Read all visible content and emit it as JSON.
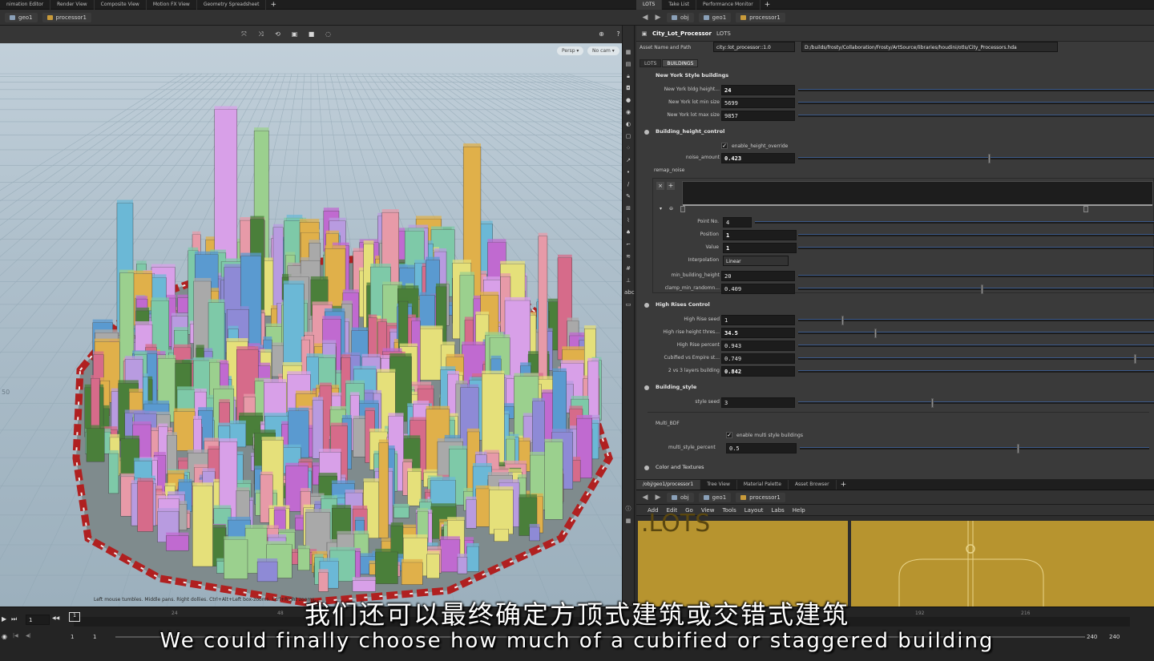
{
  "left_tabs": [
    "nimation Editor",
    "Render View",
    "Composite View",
    "Motion FX View",
    "Geometry Spreadsheet"
  ],
  "right_tabs": [
    "LOTS",
    "Take List",
    "Performance Monitor"
  ],
  "left_path": {
    "network": "geo1",
    "node": "processor1"
  },
  "right_path": {
    "obj": "obj",
    "network": "geo1",
    "node": "processor1"
  },
  "viewport": {
    "persp_label": "Persp ▾",
    "cam_label": "No cam ▾",
    "hint": "Left mouse tumbles. Middle pans. Right dollies. Ctrl+Alt+Left box-zooms. Ctrl+Right zooms.",
    "grid_label": "50"
  },
  "params": {
    "node_name": "City_Lot_Processor",
    "node_type": "LOTS",
    "asset_label": "Asset Name and Path",
    "asset_name": "city::lot_processor::1.0",
    "asset_path": "D:/builds/frosty/Collaboration/Frosty/ArtSource/libraries/houdini/otls/City_Processors.hda",
    "subtabs": [
      "LOTS",
      "BUILDINGS"
    ],
    "ny_folder": "New York Style buildings",
    "ny_height_label": "New York bldg height...",
    "ny_height": "24",
    "ny_min_label": "New York lot min size",
    "ny_min": "5699",
    "ny_max_label": "New York lot max size",
    "ny_max": "9857",
    "bhc_folder": "Building_height_control",
    "override_label": "enable_height_override",
    "noise_label": "noise_amount",
    "noise": "0.423",
    "remap_label": "remap_noise",
    "point_no_label": "Point No.",
    "point_no": "4",
    "position_label": "Position",
    "position": "1",
    "value_label": "Value",
    "value": "1",
    "interp_label": "Interpolation",
    "interp": "Linear",
    "min_bh_label": "min_building_height",
    "min_bh": "20",
    "clamp_label": "clamp_min_randomn...",
    "clamp": "0.409",
    "hr_folder": "High Rises Control",
    "hr_seed_label": "High Rise seed",
    "hr_seed": "1",
    "hr_thresh_label": "High rise height thres...",
    "hr_thresh": "34.5",
    "hr_pct_label": "High Rise percent",
    "hr_pct": "0.943",
    "cub_label": "Cubified vs Empire st...",
    "cub": "0.749",
    "layers_label": "2 vs 3 layers building",
    "layers": "0.842",
    "bs_folder": "Building_style",
    "style_seed_label": "style seed",
    "style_seed": "3",
    "multi_bdf_label": "Multi_BDF",
    "multi_enable_label": "enable multi style buildings",
    "multi_pct_label": "multi_style_percent",
    "multi_pct": "0.5",
    "color_folder": "Color and Textures"
  },
  "net": {
    "tabs": [
      "/obj/geo1/processor1",
      "Tree View",
      "Material Palette",
      "Asset Browser"
    ],
    "menu": [
      "Add",
      "Edit",
      "Go",
      "View",
      "Tools",
      "Layout",
      "Labs",
      "Help"
    ],
    "label": ".LOTS"
  },
  "timeline": {
    "frame": "1",
    "ticks": [
      "24",
      "48",
      "192",
      "216"
    ],
    "start": "1",
    "start2": "1",
    "end": "240",
    "end2": "240"
  },
  "subtitles": {
    "cn": "我们还可以最终确定方顶式建筑或交错式建筑",
    "en": "We could finally choose how much of a cubified or staggered building"
  }
}
